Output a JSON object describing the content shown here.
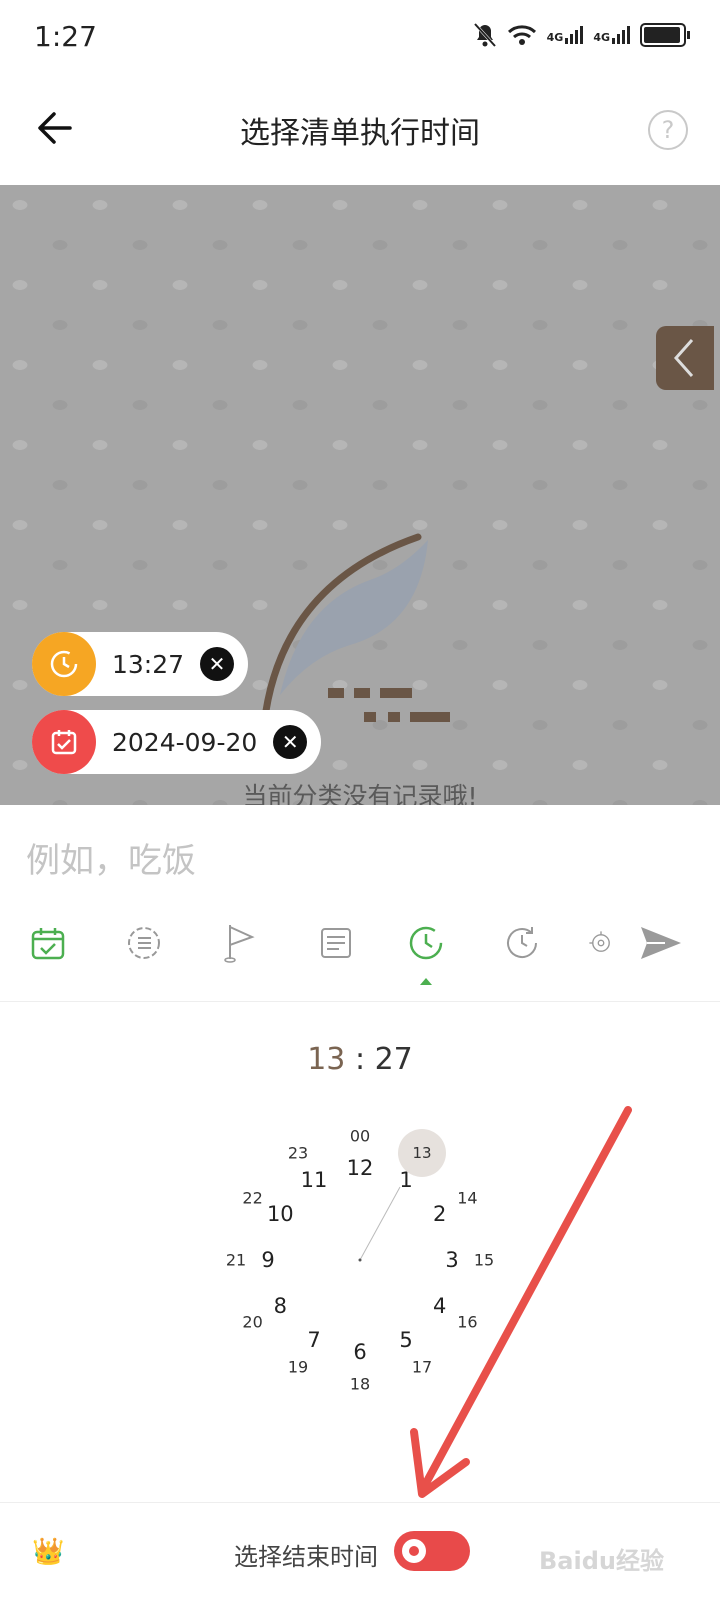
{
  "status_bar": {
    "time": "1:27",
    "network_1": "4G",
    "network_2": "4G"
  },
  "header": {
    "title": "选择清单执行时间",
    "help_label": "?"
  },
  "list_area": {
    "empty_text": "当前分类没有记录哦!"
  },
  "chips": [
    {
      "text": "13:27",
      "icon": "clock-icon",
      "color": "#f6a623"
    },
    {
      "text": "2024-09-20",
      "icon": "calendar-icon",
      "color": "#ef4b4b"
    }
  ],
  "input": {
    "placeholder": "例如，吃饭",
    "value": ""
  },
  "toolbar": {
    "items": [
      "calendar-check-icon",
      "list-icon",
      "flag-icon",
      "notes-icon",
      "time-icon",
      "repeat-icon",
      "location-icon",
      "send-icon"
    ],
    "active_item": "time-icon",
    "accent": "#4caf50"
  },
  "time_picker": {
    "hour": "13",
    "separator": ":",
    "minute": "27",
    "inner_numbers": [
      "12",
      "1",
      "2",
      "3",
      "4",
      "5",
      "6",
      "7",
      "8",
      "9",
      "10",
      "11"
    ],
    "outer_numbers": [
      "00",
      "13",
      "14",
      "15",
      "16",
      "17",
      "18",
      "19",
      "20",
      "21",
      "22",
      "23"
    ],
    "selected": "13"
  },
  "bottom_bar": {
    "end_time_label": "选择结束时间",
    "end_time_enabled": true,
    "watermark": "Baidu经验"
  },
  "colors": {
    "accent_green": "#4caf50",
    "toggle_red": "#e84a4a",
    "hour_brown": "#7a6451",
    "overlay_arrow": "#e8504a"
  }
}
